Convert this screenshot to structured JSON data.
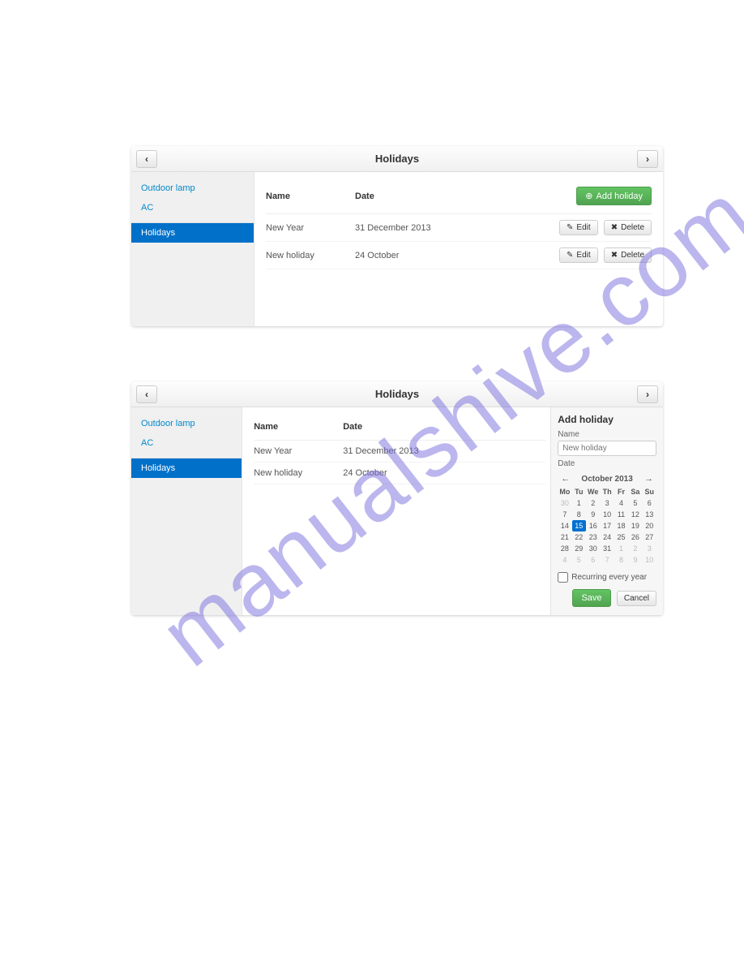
{
  "header": {
    "title": "Holidays"
  },
  "nav": {
    "prev": "‹",
    "next": "›"
  },
  "sidebar": {
    "items": [
      {
        "label": "Outdoor lamp"
      },
      {
        "label": "AC"
      },
      {
        "label": "Holidays",
        "active": true
      }
    ]
  },
  "table": {
    "columns": {
      "name": "Name",
      "date": "Date"
    },
    "rows": [
      {
        "name": "New Year",
        "date": "31 December 2013"
      },
      {
        "name": "New holiday",
        "date": "24 October"
      }
    ]
  },
  "buttons": {
    "add": "Add holiday",
    "edit": "Edit",
    "delete": "Delete",
    "save": "Save",
    "cancel": "Cancel"
  },
  "form": {
    "title": "Add holiday",
    "name_label": "Name",
    "name_placeholder": "New holiday",
    "date_label": "Date",
    "recurring_label": "Recurring every year"
  },
  "calendar": {
    "month_label": "October 2013",
    "prev": "←",
    "next": "→",
    "dow": [
      "Mo",
      "Tu",
      "We",
      "Th",
      "Fr",
      "Sa",
      "Su"
    ],
    "weeks": [
      [
        {
          "d": "30",
          "m": true
        },
        {
          "d": "1"
        },
        {
          "d": "2"
        },
        {
          "d": "3"
        },
        {
          "d": "4"
        },
        {
          "d": "5"
        },
        {
          "d": "6"
        }
      ],
      [
        {
          "d": "7"
        },
        {
          "d": "8"
        },
        {
          "d": "9"
        },
        {
          "d": "10"
        },
        {
          "d": "11"
        },
        {
          "d": "12"
        },
        {
          "d": "13"
        }
      ],
      [
        {
          "d": "14"
        },
        {
          "d": "15",
          "sel": true
        },
        {
          "d": "16"
        },
        {
          "d": "17"
        },
        {
          "d": "18"
        },
        {
          "d": "19"
        },
        {
          "d": "20"
        }
      ],
      [
        {
          "d": "21"
        },
        {
          "d": "22"
        },
        {
          "d": "23"
        },
        {
          "d": "24"
        },
        {
          "d": "25"
        },
        {
          "d": "26"
        },
        {
          "d": "27"
        }
      ],
      [
        {
          "d": "28"
        },
        {
          "d": "29"
        },
        {
          "d": "30"
        },
        {
          "d": "31"
        },
        {
          "d": "1",
          "m": true
        },
        {
          "d": "2",
          "m": true
        },
        {
          "d": "3",
          "m": true
        }
      ],
      [
        {
          "d": "4",
          "m": true
        },
        {
          "d": "5",
          "m": true
        },
        {
          "d": "6",
          "m": true
        },
        {
          "d": "7",
          "m": true
        },
        {
          "d": "8",
          "m": true
        },
        {
          "d": "9",
          "m": true
        },
        {
          "d": "10",
          "m": true
        }
      ]
    ]
  },
  "watermark": "manualshive.com"
}
